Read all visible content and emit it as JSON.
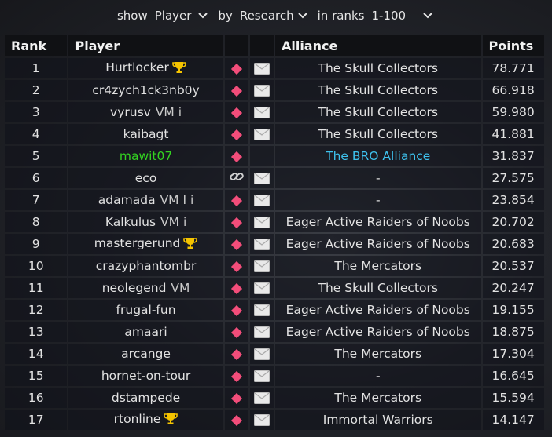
{
  "filters": {
    "show_label": "show",
    "show_value": "Player",
    "by_label": "by",
    "by_value": "Research",
    "ranks_label": "in ranks",
    "ranks_value": "1-100"
  },
  "columns": {
    "rank": "Rank",
    "player": "Player",
    "alliance": "Alliance",
    "points": "Points"
  },
  "rows": [
    {
      "rank": "1",
      "player": "Hurtlocker",
      "flags": "",
      "trophy": true,
      "action": "diamond",
      "mail": true,
      "alliance": "The Skull Collectors",
      "points": "78.771",
      "style": ""
    },
    {
      "rank": "2",
      "player": "cr4zych1ck3nb0y",
      "flags": "",
      "trophy": false,
      "action": "diamond",
      "mail": true,
      "alliance": "The Skull Collectors",
      "points": "66.918",
      "style": ""
    },
    {
      "rank": "3",
      "player": "vyrusv",
      "flags": "VM i",
      "trophy": false,
      "action": "diamond",
      "mail": true,
      "alliance": "The Skull Collectors",
      "points": "59.980",
      "style": ""
    },
    {
      "rank": "4",
      "player": "kaibagt",
      "flags": "",
      "trophy": false,
      "action": "diamond",
      "mail": true,
      "alliance": "The Skull Collectors",
      "points": "41.881",
      "style": ""
    },
    {
      "rank": "5",
      "player": "mawit07",
      "flags": "",
      "trophy": false,
      "action": "diamond",
      "mail": false,
      "alliance": "The BRO Alliance",
      "points": "31.837",
      "style": "self"
    },
    {
      "rank": "6",
      "player": "eco",
      "flags": "",
      "trophy": false,
      "action": "link",
      "mail": true,
      "alliance": "-",
      "points": "27.575",
      "style": ""
    },
    {
      "rank": "7",
      "player": "adamada",
      "flags": "VM I i",
      "trophy": false,
      "action": "diamond",
      "mail": true,
      "alliance": "-",
      "points": "23.854",
      "style": ""
    },
    {
      "rank": "8",
      "player": "Kalkulus",
      "flags": "VM i",
      "trophy": false,
      "action": "diamond",
      "mail": true,
      "alliance": "Eager Active Raiders of Noobs",
      "points": "20.702",
      "style": ""
    },
    {
      "rank": "9",
      "player": "mastergerund",
      "flags": "",
      "trophy": true,
      "action": "diamond",
      "mail": true,
      "alliance": "Eager Active Raiders of Noobs",
      "points": "20.683",
      "style": ""
    },
    {
      "rank": "10",
      "player": "crazyphantombr",
      "flags": "",
      "trophy": false,
      "action": "diamond",
      "mail": true,
      "alliance": "The Mercators",
      "points": "20.537",
      "style": ""
    },
    {
      "rank": "11",
      "player": "neolegend",
      "flags": "VM",
      "trophy": false,
      "action": "diamond",
      "mail": true,
      "alliance": "The Skull Collectors",
      "points": "20.247",
      "style": ""
    },
    {
      "rank": "12",
      "player": "frugal-fun",
      "flags": "",
      "trophy": false,
      "action": "diamond",
      "mail": true,
      "alliance": "Eager Active Raiders of Noobs",
      "points": "19.155",
      "style": ""
    },
    {
      "rank": "13",
      "player": "amaari",
      "flags": "",
      "trophy": false,
      "action": "diamond",
      "mail": true,
      "alliance": "Eager Active Raiders of Noobs",
      "points": "18.875",
      "style": ""
    },
    {
      "rank": "14",
      "player": "arcange",
      "flags": "",
      "trophy": false,
      "action": "diamond",
      "mail": true,
      "alliance": "The Mercators",
      "points": "17.304",
      "style": ""
    },
    {
      "rank": "15",
      "player": "hornet-on-tour",
      "flags": "",
      "trophy": false,
      "action": "diamond",
      "mail": true,
      "alliance": "-",
      "points": "16.645",
      "style": ""
    },
    {
      "rank": "16",
      "player": "dstampede",
      "flags": "",
      "trophy": false,
      "action": "diamond",
      "mail": true,
      "alliance": "The Mercators",
      "points": "15.594",
      "style": ""
    },
    {
      "rank": "17",
      "player": "rtonline",
      "flags": "",
      "trophy": true,
      "action": "diamond",
      "mail": true,
      "alliance": "Immortal Warriors",
      "points": "14.147",
      "style": ""
    }
  ],
  "icons": {
    "trophy": "trophy-icon",
    "action_diamond": "diamond-icon",
    "action_link": "link-icon",
    "mail": "mail-icon",
    "chevron": "chevron-down-icon"
  },
  "colors": {
    "self_player": "#33d321",
    "self_alliance": "#3ec2ee",
    "diamond": "#f24d7a",
    "trophy": "#f5c400"
  }
}
